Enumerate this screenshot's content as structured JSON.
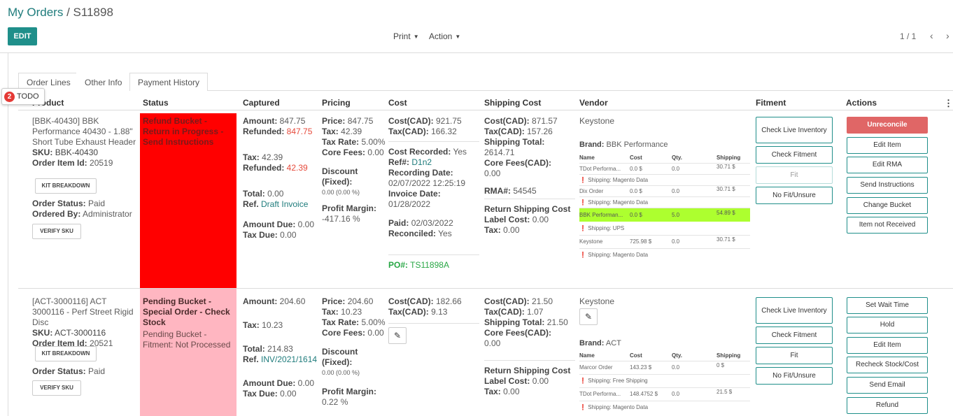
{
  "breadcrumb": {
    "parent": "My Orders",
    "sep": "/",
    "current": "S11898"
  },
  "toolbar": {
    "edit": "EDIT",
    "print": "Print",
    "action": "Action",
    "pager": "1 / 1",
    "prev_icon": "chevron-left-icon",
    "next_icon": "chevron-right-icon"
  },
  "tabs": [
    "Order Lines",
    "Other Info",
    "Payment History"
  ],
  "todo": {
    "count": "2",
    "label": "TODO"
  },
  "columns": [
    "Product",
    "Status",
    "Captured",
    "Pricing",
    "Cost",
    "Shipping Cost",
    "Vendor",
    "Fitment",
    "Actions"
  ],
  "colors": {
    "accent": "#1f8f8a",
    "refund_red": "#ff0000",
    "pending_pink": "#ffb6c1",
    "highlight": "#adff2f",
    "unreconcile": "#e06666"
  },
  "rows": [
    {
      "product": {
        "name": "[BBK-40430] BBK Performance 40430 - 1.88\" Short Tube Exhaust Header",
        "sku_label": "SKU:",
        "sku": "BBK-40430",
        "item_label": "Order Item Id:",
        "item_id": "20519",
        "kit_btn": "KIT BREAKDOWN",
        "status_label": "Order Status:",
        "status": "Paid",
        "ordered_label": "Ordered By:",
        "ordered_by": "Administrator",
        "verify_btn": "VERIFY SKU"
      },
      "status": {
        "text": "Refund Bucket - Return in Progress - Send Instructions",
        "sub": ""
      },
      "captured": {
        "amount_label": "Amount:",
        "amount": "847.75",
        "refunded_label": "Refunded:",
        "refunded": "847.75",
        "tax_label": "Tax:",
        "tax": "42.39",
        "refunded2_label": "Refunded:",
        "refunded2": "42.39",
        "total_label": "Total:",
        "total": "0.00",
        "ref_label": "Ref.",
        "ref": "Draft Invoice",
        "due_label": "Amount Due:",
        "due": "0.00",
        "taxdue_label": "Tax Due:",
        "taxdue": "0.00"
      },
      "pricing": {
        "price_label": "Price:",
        "price": "847.75",
        "tax_label": "Tax:",
        "tax": "42.39",
        "rate_label": "Tax Rate:",
        "rate": "5.00%",
        "core_label": "Core Fees:",
        "core": "0.00",
        "disc_label": "Discount (Fixed):",
        "disc": "0.00 (0.00 %)",
        "margin_label": "Profit Margin:",
        "margin": "-417.16 %"
      },
      "cost": {
        "cost_label": "Cost(CAD):",
        "cost": "921.75",
        "tax_label": "Tax(CAD):",
        "tax": "166.32",
        "recorded_label": "Cost Recorded:",
        "recorded": "Yes",
        "ref_label": "Ref#:",
        "ref": "D1n2",
        "rec_date_label": "Recording Date:",
        "rec_date": "02/07/2022 12:25:19",
        "inv_date_label": "Invoice Date:",
        "inv_date": "01/28/2022",
        "paid_label": "Paid:",
        "paid": "02/03/2022",
        "reconciled_label": "Reconciled:",
        "reconciled": "Yes",
        "po_label": "PO#:",
        "po": "TS11898A"
      },
      "shipping": {
        "cost_label": "Cost(CAD):",
        "cost": "871.57",
        "tax_label": "Tax(CAD):",
        "tax": "157.26",
        "total_label": "Shipping Total:",
        "total": "2614.71",
        "core_label": "Core Fees(CAD):",
        "core": "0.00",
        "rma_label": "RMA#:",
        "rma": "54545",
        "ret_label": "Return Shipping Cost",
        "label_label": "Label Cost:",
        "label": "0.00",
        "rtax_label": "Tax:",
        "rtax": "0.00"
      },
      "vendor": {
        "name": "Keystone",
        "brand_label": "Brand:",
        "brand": "BBK Performance",
        "headers": [
          "Name",
          "Cost",
          "Qty.",
          "Shipping"
        ],
        "lines": [
          {
            "name": "TDot Performa...",
            "cost": "0.0 $",
            "qty": "0.0",
            "ship": "30.71 $",
            "note": "Shipping: Magento Data"
          },
          {
            "name": "Dix Order",
            "cost": "0.0 $",
            "qty": "0.0",
            "ship": "30.71 $",
            "note": "Shipping: Magento Data"
          },
          {
            "name": "BBK Performan...",
            "cost": "0.0 $",
            "qty": "5.0",
            "ship": "54.89 $",
            "note": "Shipping: UPS"
          },
          {
            "name": "Keystone",
            "cost": "725.98 $",
            "qty": "0.0",
            "ship": "30.71 $",
            "note": "Shipping: Magento Data"
          }
        ]
      },
      "fitment": [
        "Check Live Inventory",
        "Check Fitment",
        "Fit",
        "No Fit/Unsure"
      ],
      "actions": [
        "Unreconcile",
        "Edit Item",
        "Edit RMA",
        "Send Instructions",
        "Change Bucket",
        "Item not Received"
      ]
    },
    {
      "product": {
        "name": "[ACT-3000116] ACT 3000116 - Perf Street Rigid Disc",
        "sku_label": "SKU:",
        "sku": "ACT-3000116",
        "item_label": "Order Item Id:",
        "item_id": "20521",
        "kit_btn": "KIT BREAKDOWN",
        "status_label": "Order Status:",
        "status": "Paid",
        "verify_btn": "VERIFY SKU"
      },
      "status": {
        "text": "Pending Bucket - Special Order - Check Stock",
        "sub": "Pending Bucket - Fitment: Not Processed"
      },
      "captured": {
        "amount_label": "Amount:",
        "amount": "204.60",
        "tax_label": "Tax:",
        "tax": "10.23",
        "total_label": "Total:",
        "total": "214.83",
        "ref_label": "Ref.",
        "ref": "INV/2021/1614",
        "due_label": "Amount Due:",
        "due": "0.00",
        "taxdue_label": "Tax Due:",
        "taxdue": "0.00"
      },
      "pricing": {
        "price_label": "Price:",
        "price": "204.60",
        "tax_label": "Tax:",
        "tax": "10.23",
        "rate_label": "Tax Rate:",
        "rate": "5.00%",
        "core_label": "Core Fees:",
        "core": "0.00",
        "disc_label": "Discount (Fixed):",
        "disc": "0.00 (0.00 %)",
        "margin_label": "Profit Margin:",
        "margin": "0.22 %"
      },
      "cost": {
        "cost_label": "Cost(CAD):",
        "cost": "182.66",
        "tax_label": "Tax(CAD):",
        "tax": "9.13"
      },
      "shipping": {
        "cost_label": "Cost(CAD):",
        "cost": "21.50",
        "tax_label": "Tax(CAD):",
        "tax": "1.07",
        "total_label": "Shipping Total:",
        "total": "21.50",
        "core_label": "Core Fees(CAD):",
        "core": "0.00",
        "ret_label": "Return Shipping Cost",
        "label_label": "Label Cost:",
        "label": "0.00",
        "rtax_label": "Tax:",
        "rtax": "0.00"
      },
      "vendor": {
        "name": "Keystone",
        "brand_label": "Brand:",
        "brand": "ACT",
        "headers": [
          "Name",
          "Cost",
          "Qty.",
          "Shipping"
        ],
        "lines": [
          {
            "name": "Marcor Order",
            "cost": "143.23 $",
            "qty": "0.0",
            "ship": "0 $",
            "note": "Shipping: Free Shipping"
          },
          {
            "name": "TDot Performa...",
            "cost": "148.4752 $",
            "qty": "0.0",
            "ship": "21.5 $",
            "note": "Shipping: Magento Data"
          }
        ]
      },
      "fitment": [
        "Check Live Inventory",
        "Check Fitment",
        "Fit",
        "No Fit/Unsure"
      ],
      "actions": [
        "Set Wait Time",
        "Hold",
        "Edit Item",
        "Recheck Stock/Cost",
        "Send Email",
        "Refund"
      ]
    }
  ]
}
